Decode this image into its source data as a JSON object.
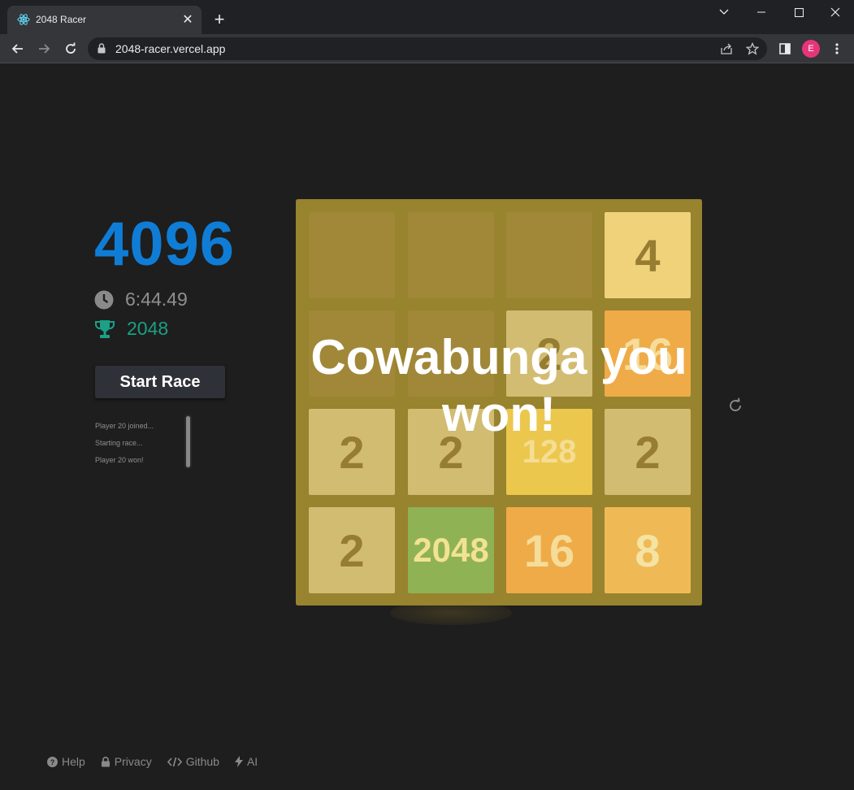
{
  "browser": {
    "tab_title": "2048 Racer",
    "url": "2048-racer.vercel.app",
    "profile_initial": "E"
  },
  "game": {
    "score": "4096",
    "timer": "6:44.49",
    "best": "2048",
    "start_button": "Start Race",
    "log": [
      "Player 20 joined...",
      "Starting race...",
      "Player 20 won!"
    ],
    "win_message": "Cowabunga you won!",
    "board": [
      [
        "",
        "",
        "",
        "4"
      ],
      [
        "",
        "",
        "2",
        "16"
      ],
      [
        "2",
        "2",
        "128",
        "2"
      ],
      [
        "2",
        "2048",
        "16",
        "8"
      ]
    ]
  },
  "footer": {
    "help": "Help",
    "privacy": "Privacy",
    "github": "Github",
    "ai": "AI"
  },
  "colors": {
    "score": "#0f7dd6",
    "best": "#1aa085",
    "board_bg": "#8d7a2e",
    "empty_cell": "#977f3a"
  }
}
